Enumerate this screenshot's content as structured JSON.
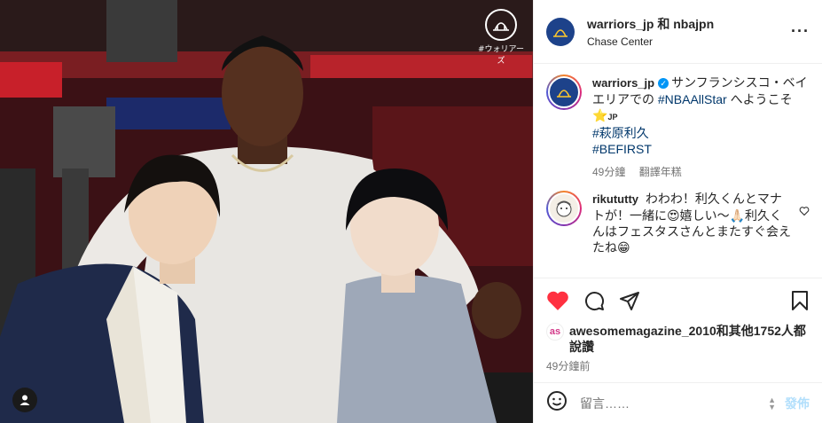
{
  "header": {
    "title": "warriors_jp 和 nbajpn",
    "location": "Chase Center"
  },
  "photo": {
    "brand_text": "#ウォリアーズ"
  },
  "caption": {
    "username": "warriors_jp",
    "text_before": "サンフランシスコ・ベイエリアでの",
    "hashtag_allstar": "#NBAAllStar",
    "text_after": "へようこそ",
    "emoji_star": "⭐",
    "jp_tag": "JP",
    "hashtag_name": "#萩原利久",
    "hashtag_group": "#BEFIRST",
    "time": "49分鐘",
    "translate": "翻譯年糕"
  },
  "comment": {
    "username": "rikututty",
    "text": "わわわ！利久くんとマナトが！一緒に😍嬉しい〜🙏🏻利久くんはフェスタスさんとまたすぐ会えたね😁"
  },
  "likes": {
    "badge": "as",
    "text": "awesomemagazine_2010和其他1752人都說讚"
  },
  "post_time": "49分鐘前",
  "composer": {
    "placeholder": "留言……",
    "post_label": "發佈"
  },
  "icons": {
    "like": "heart-icon",
    "comment": "comment-icon",
    "share": "share-icon",
    "save": "bookmark-icon",
    "emoji": "emoji-icon",
    "more": "more-icon"
  },
  "colors": {
    "like_red": "#ff3040",
    "link_blue": "#00376b",
    "post_blue": "#b2dffc",
    "warriors_blue": "#1d428a"
  }
}
